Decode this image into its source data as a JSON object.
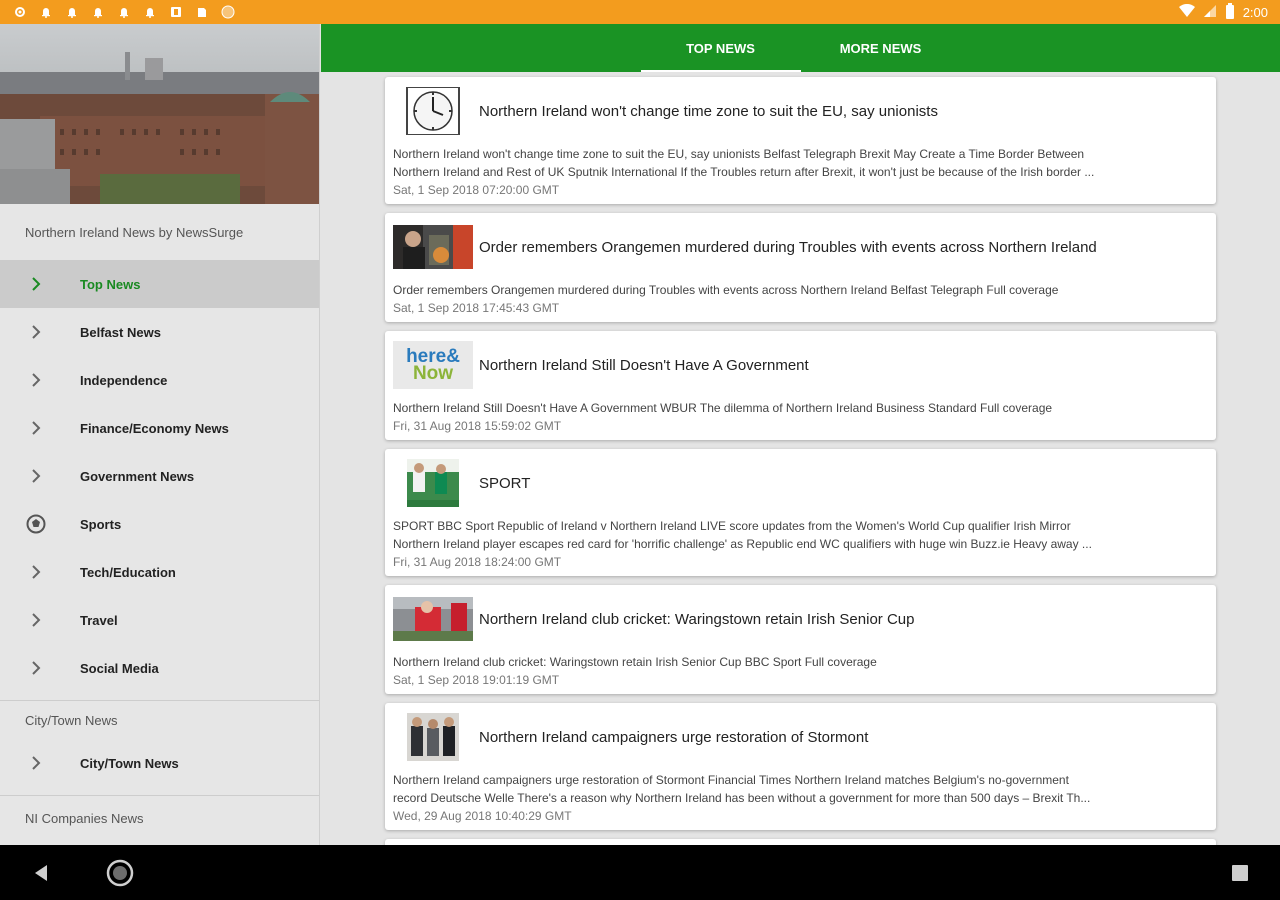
{
  "status_bar": {
    "time": "2:00",
    "icons_left": [
      "gear-icon",
      "bell-icon",
      "bell-icon",
      "bell-icon",
      "bell-icon",
      "bell-icon",
      "square-icon",
      "square-icon",
      "circle-icon"
    ],
    "icons_right": [
      "wifi-icon",
      "signal-icon",
      "battery-icon"
    ]
  },
  "drawer": {
    "header_image": "city-skyline-image",
    "section_1_title": "Northern Ireland News by NewsSurge",
    "items": [
      {
        "label": "Top News",
        "icon": "chevron-right-icon",
        "active": true
      },
      {
        "label": "Belfast News",
        "icon": "chevron-right-icon"
      },
      {
        "label": "Independence",
        "icon": "chevron-right-icon"
      },
      {
        "label": "Finance/Economy News",
        "icon": "chevron-right-icon"
      },
      {
        "label": "Government News",
        "icon": "chevron-right-icon"
      },
      {
        "label": "Sports",
        "icon": "soccer-ball-icon"
      },
      {
        "label": "Tech/Education",
        "icon": "chevron-right-icon"
      },
      {
        "label": "Travel",
        "icon": "chevron-right-icon"
      },
      {
        "label": "Social Media",
        "icon": "chevron-right-icon"
      }
    ],
    "section_2_title": "City/Town News",
    "items_2": [
      {
        "label": "City/Town News",
        "icon": "chevron-right-icon"
      }
    ],
    "section_3_title": "NI Companies News"
  },
  "tabs": [
    {
      "label": "TOP NEWS",
      "active": true
    },
    {
      "label": "MORE NEWS",
      "active": false
    }
  ],
  "cards": [
    {
      "thumb": "clock-image",
      "title": "Northern Ireland won't change time zone to suit the EU, say unionists",
      "desc_1": "Northern Ireland won't change time zone to suit the EU, say unionists  Belfast Telegraph  Brexit May Create a Time Border Between",
      "desc_2": "Northern Ireland and Rest of UK  Sputnik International  If the Troubles return after Brexit, it won't just be because of the Irish border ...",
      "date": "Sat, 1 Sep 2018 07:20:00 GMT"
    },
    {
      "thumb": "orangemen-photo",
      "title": "Order remembers Orangemen murdered during Troubles with events across Northern Ireland",
      "desc_1": "Order remembers Orangemen murdered during Troubles with events across Northern Ireland  Belfast Telegraph  Full coverage",
      "date": "Sat, 1 Sep 2018 17:45:43 GMT"
    },
    {
      "thumb": "here-and-now-logo",
      "thumb_text_1": "here&",
      "thumb_text_2": "Now",
      "title": "Northern Ireland Still Doesn't Have A Government",
      "desc_1": "Northern Ireland Still Doesn't Have A Government  WBUR  The dilemma of Northern Ireland  Business Standard  Full coverage",
      "date": "Fri, 31 Aug 2018 15:59:02 GMT"
    },
    {
      "thumb": "football-photo",
      "title": "SPORT",
      "desc_1": "SPORT  BBC Sport  Republic of Ireland v Northern Ireland LIVE score updates from the Women's World Cup qualifier  Irish Mirror",
      "desc_2": "Northern Ireland player escapes red card for 'horrific challenge' as Republic end WC qualifiers with huge win  Buzz.ie  Heavy away ...",
      "date": "Fri, 31 Aug 2018 18:24:00 GMT"
    },
    {
      "thumb": "cricket-photo",
      "title": "Northern Ireland club cricket: Waringstown retain Irish Senior Cup",
      "desc_1": "Northern Ireland club cricket: Waringstown retain Irish Senior Cup  BBC Sport  Full coverage",
      "date": "Sat, 1 Sep 2018 19:01:19 GMT"
    },
    {
      "thumb": "campaigners-photo",
      "title": "Northern Ireland campaigners urge restoration of Stormont",
      "desc_1": "Northern Ireland campaigners urge restoration of Stormont  Financial Times  Northern Ireland matches Belgium's no-government",
      "desc_2": "record  Deutsche Welle  There's a reason why Northern Ireland has been without a government for more than 500 days – Brexit  Th...",
      "date": "Wed, 29 Aug 2018 10:40:29 GMT"
    }
  ],
  "nav_bar": {
    "back": "back-icon",
    "home": "home-icon",
    "recents": "recents-icon"
  },
  "colors": {
    "status_bar": "#f39c1e",
    "app_bar": "#1a9324",
    "active_label": "#1a8a22"
  }
}
